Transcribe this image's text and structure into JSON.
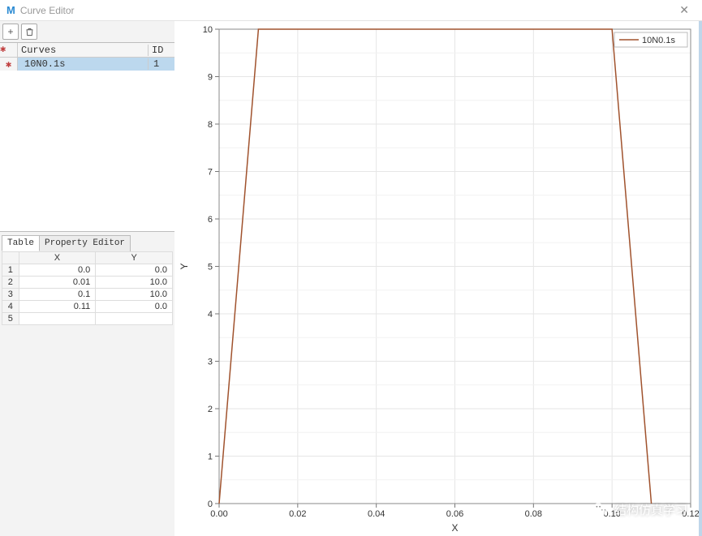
{
  "window": {
    "title": "Curve Editor",
    "app_icon_letter": "M"
  },
  "toolbar": {
    "add_tooltip": "+",
    "delete_tooltip": "🗑"
  },
  "curve_list": {
    "header_curves": "Curves",
    "header_id": "ID",
    "rows": [
      {
        "name": "10N0.1s",
        "id": "1"
      }
    ]
  },
  "tabs": {
    "table": "Table",
    "property": "Property Editor"
  },
  "xy_table": {
    "x_header": "X",
    "y_header": "Y",
    "rows": [
      {
        "n": "1",
        "x": "0.0",
        "y": "0.0"
      },
      {
        "n": "2",
        "x": "0.01",
        "y": "10.0"
      },
      {
        "n": "3",
        "x": "0.1",
        "y": "10.0"
      },
      {
        "n": "4",
        "x": "0.11",
        "y": "0.0"
      },
      {
        "n": "5",
        "x": "",
        "y": ""
      }
    ]
  },
  "chart_data": {
    "type": "line",
    "title": "",
    "xlabel": "X",
    "ylabel": "Y",
    "xlim": [
      0.0,
      0.12
    ],
    "ylim": [
      0,
      10
    ],
    "x_ticks": [
      "0.00",
      "0.02",
      "0.04",
      "0.06",
      "0.08",
      "0.10",
      "0.12"
    ],
    "y_ticks": [
      "0",
      "1",
      "2",
      "3",
      "4",
      "5",
      "6",
      "7",
      "8",
      "9",
      "10"
    ],
    "series": [
      {
        "name": "10N0.1s",
        "color": "#a0522d",
        "x": [
          0.0,
          0.01,
          0.1,
          0.11
        ],
        "y": [
          0.0,
          10.0,
          10.0,
          0.0
        ]
      }
    ]
  },
  "watermark": {
    "text": "结构仿真学习"
  }
}
